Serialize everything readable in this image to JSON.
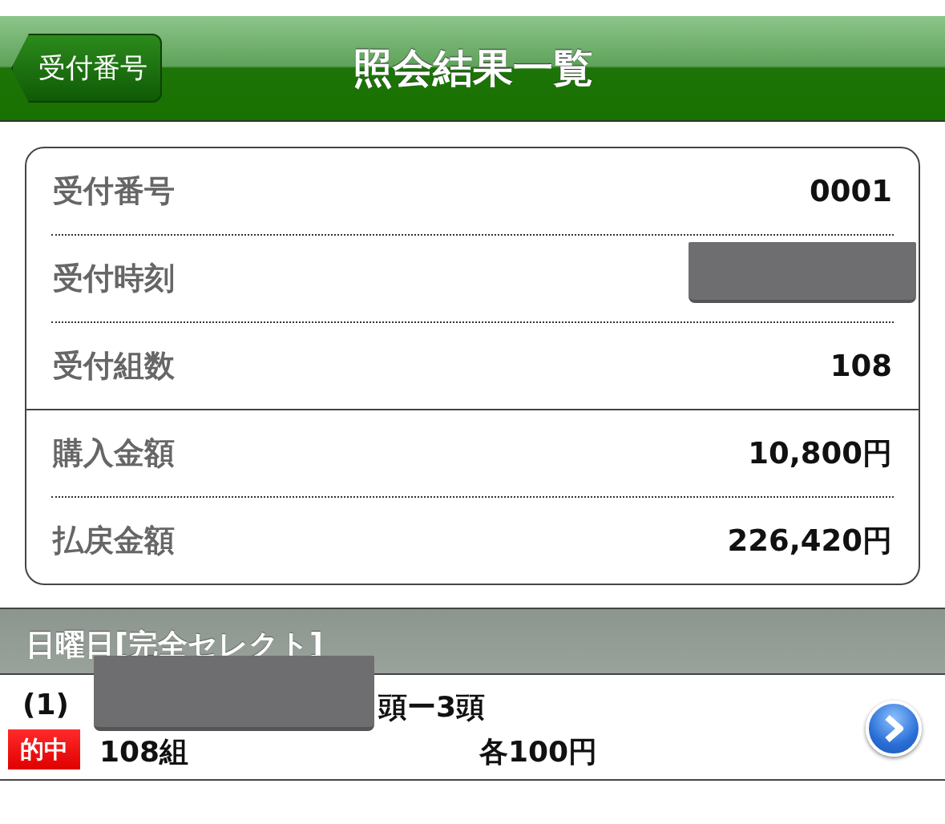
{
  "nav_bar": {
    "back_button": "受付番号",
    "title": "照会結果一覧"
  },
  "summary": {
    "groups": [
      [
        {
          "label": "受付番号",
          "value": "0001",
          "redacted": false
        },
        {
          "label": "受付時刻",
          "redacted": true
        },
        {
          "label": "受付組数",
          "value": "108",
          "redacted": false
        }
      ],
      [
        {
          "label": "購入金額",
          "value": "10,800円",
          "redacted": false
        },
        {
          "label": "払戻金額",
          "value": "226,420円",
          "redacted": false
        }
      ]
    ]
  },
  "section": {
    "title": "日曜日[完全セレクト]",
    "bets": [
      {
        "number": "(1)",
        "detail": "頭ー3頭",
        "badge": "的中",
        "combinations": "108組",
        "amount": "各100円",
        "redacted": true
      }
    ]
  }
}
